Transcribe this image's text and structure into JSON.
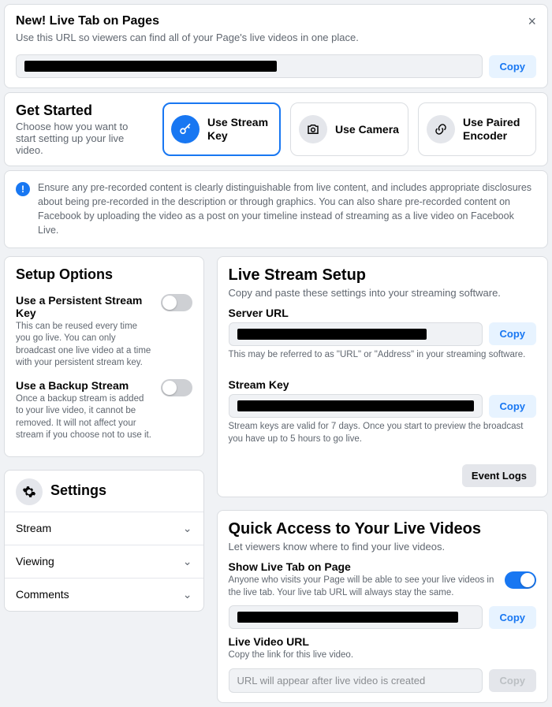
{
  "banner": {
    "title": "New! Live Tab on Pages",
    "subtitle": "Use this URL so viewers can find all of your Page's live videos in one place.",
    "copy": "Copy"
  },
  "get_started": {
    "title": "Get Started",
    "subtitle": "Choose how you want to start setting up your live video.",
    "options": [
      {
        "label": "Use Stream Key"
      },
      {
        "label": "Use Camera"
      },
      {
        "label": "Use Paired Encoder"
      }
    ]
  },
  "info": {
    "text": "Ensure any pre-recorded content is clearly distinguishable from live content, and includes appropriate disclosures about being pre-recorded in the description or through graphics. You can also share pre-recorded content on Facebook by uploading the video as a post on your timeline instead of streaming as a live video on Facebook Live."
  },
  "setup_options": {
    "title": "Setup Options",
    "persistent": {
      "title": "Use a Persistent Stream Key",
      "desc": "This can be reused every time you go live. You can only broadcast one live video at a time with your persistent stream key."
    },
    "backup": {
      "title": "Use a Backup Stream",
      "desc": "Once a backup stream is added to your live video, it cannot be removed. It will not affect your stream if you choose not to use it."
    }
  },
  "settings": {
    "title": "Settings",
    "items": [
      "Stream",
      "Viewing",
      "Comments"
    ]
  },
  "live_stream": {
    "title": "Live Stream Setup",
    "subtitle": "Copy and paste these settings into your streaming software.",
    "server_label": "Server URL",
    "server_note": "This may be referred to as \"URL\" or \"Address\" in your streaming software.",
    "key_label": "Stream Key",
    "key_note": "Stream keys are valid for 7 days. Once you start to preview the broadcast you have up to 5 hours to go live.",
    "copy": "Copy",
    "event_logs": "Event Logs"
  },
  "quick_access": {
    "title": "Quick Access to Your Live Videos",
    "subtitle": "Let viewers know where to find your live videos.",
    "show_tab_title": "Show Live Tab on Page",
    "show_tab_desc": "Anyone who visits your Page will be able to see your live videos in the live tab. Your live tab URL will always stay the same.",
    "live_video_url_title": "Live Video URL",
    "live_video_url_desc": "Copy the link for this live video.",
    "placeholder": "URL will appear after live video is created",
    "copy": "Copy"
  }
}
